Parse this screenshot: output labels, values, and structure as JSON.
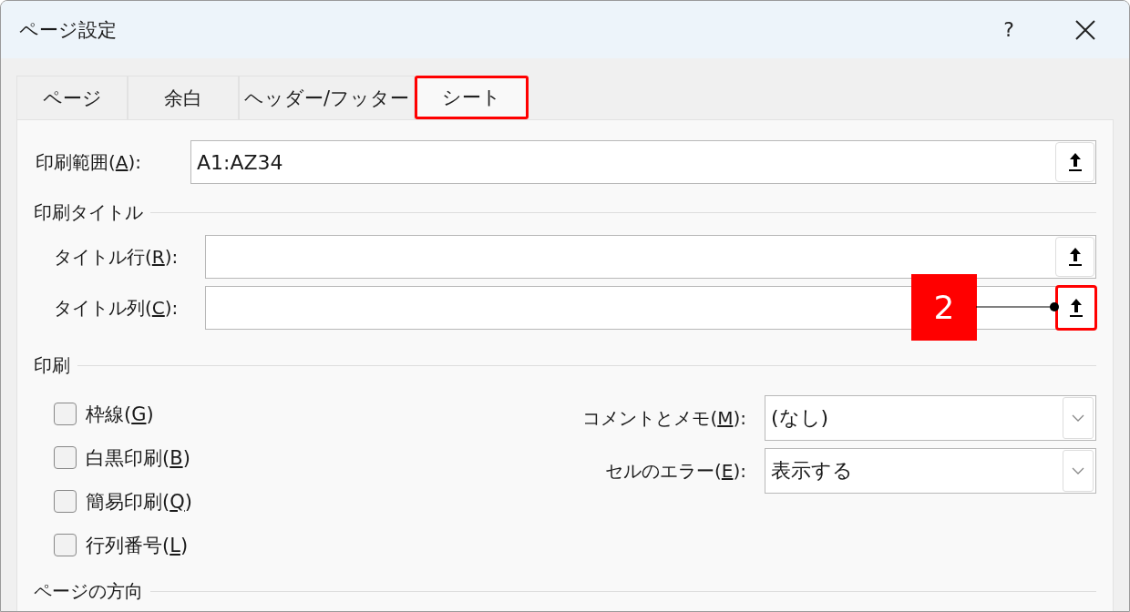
{
  "window": {
    "title": "ページ設定",
    "help": "?"
  },
  "tabs": [
    {
      "label": "ページ",
      "selected": false,
      "highlighted": false
    },
    {
      "label": "余白",
      "selected": false,
      "highlighted": false
    },
    {
      "label": "ヘッダー/フッター",
      "selected": false,
      "highlighted": false
    },
    {
      "label": "シート",
      "selected": true,
      "highlighted": true
    }
  ],
  "print_area": {
    "label_before": "印刷範囲(",
    "access_key": "A",
    "label_after": "):",
    "value": "A1:AZ34",
    "highlighted": false
  },
  "print_titles": {
    "title": "印刷タイトル",
    "fields": [
      {
        "label_before": "タイトル行(",
        "access_key": "R",
        "label_after": "):",
        "highlighted": false
      },
      {
        "label_before": "タイトル列(",
        "access_key": "C",
        "label_after": "):",
        "highlighted": true,
        "callout": "2"
      }
    ]
  },
  "print": {
    "title": "印刷",
    "options": [
      {
        "label_before": "枠線(",
        "access_key": "G",
        "label_after": ")",
        "checked": false
      },
      {
        "label_before": "白黒印刷(",
        "access_key": "B",
        "label_after": ")",
        "checked": false
      },
      {
        "label_before": "簡易印刷(",
        "access_key": "Q",
        "label_after": ")",
        "checked": false
      },
      {
        "label_before": "行列番号(",
        "access_key": "L",
        "label_after": ")",
        "checked": false
      }
    ],
    "dropdowns": [
      {
        "label_before": "コメントとメモ(",
        "access_key": "M",
        "label_after": "):",
        "value": "(なし)"
      },
      {
        "label_before": "セルのエラー(",
        "access_key": "E",
        "label_after": "):",
        "value": "表示する"
      }
    ]
  },
  "orientation": {
    "title": "ページの方向"
  }
}
